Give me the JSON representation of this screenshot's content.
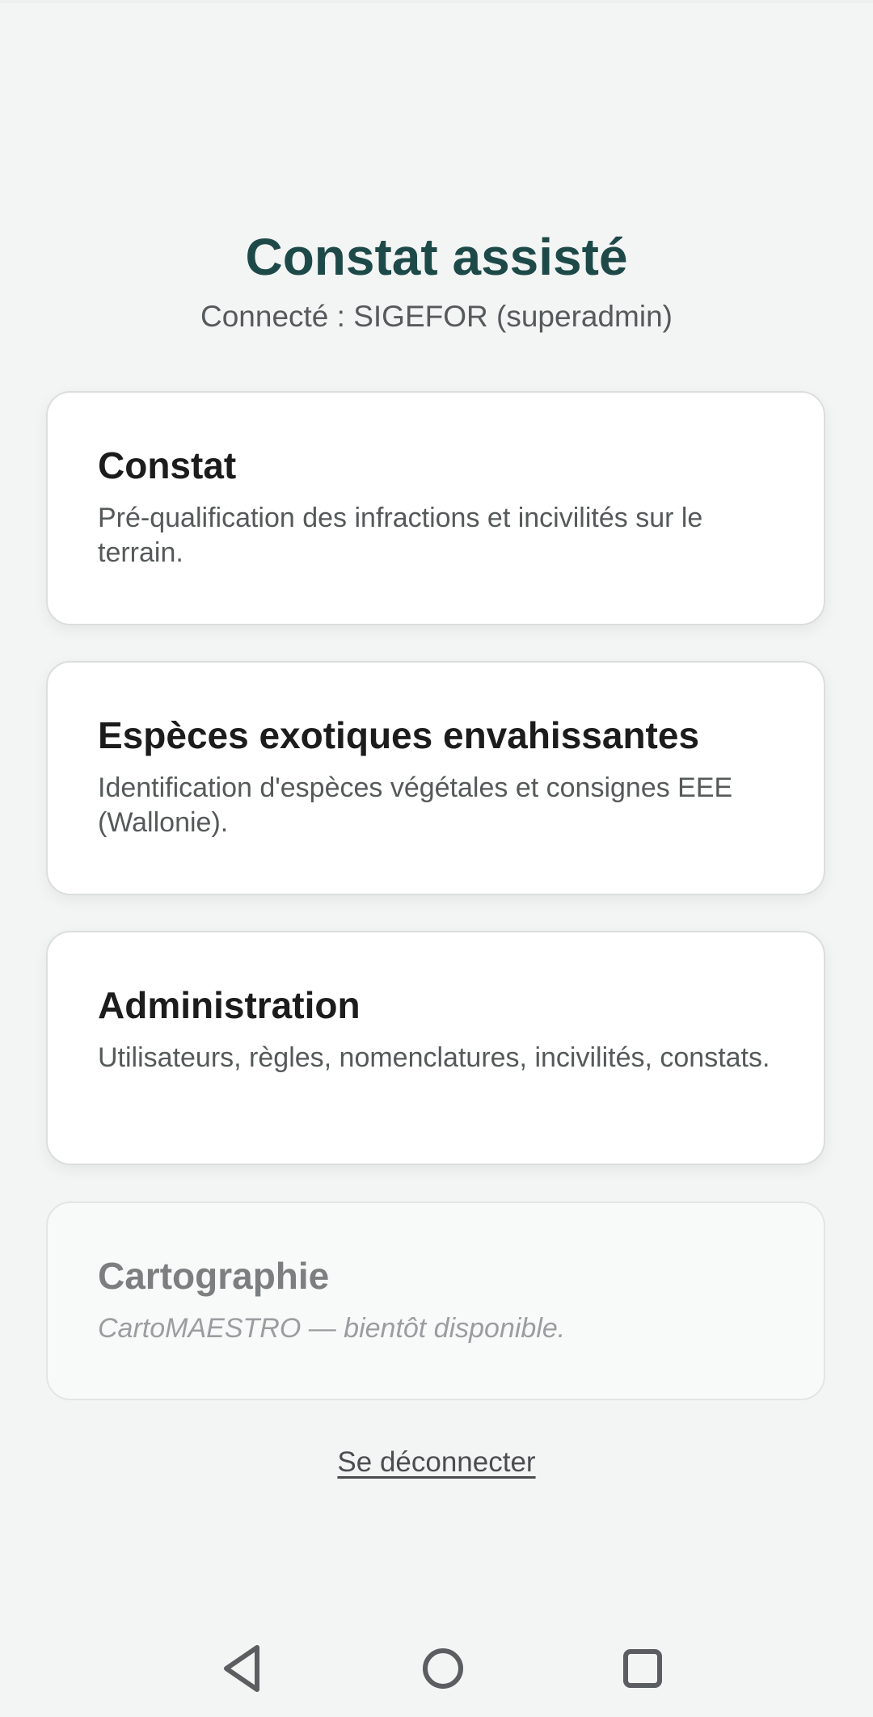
{
  "app": {
    "title": "Constat assisté",
    "subtitle": "Connecté : SIGEFOR (superadmin)"
  },
  "cards": [
    {
      "title": "Constat",
      "description": "Pré-qualification des infractions et incivilités sur le terrain.",
      "enabled": true
    },
    {
      "title": "Espèces exotiques envahissantes",
      "description": "Identification d'espèces végétales et consignes EEE (Wallonie).",
      "enabled": true
    },
    {
      "title": "Administration",
      "description": "Utilisateurs, règles, nomenclatures, incivilités, constats.",
      "enabled": true
    },
    {
      "title": "Cartographie",
      "description": "CartoMAESTRO — bientôt disponible.",
      "enabled": false
    }
  ],
  "logout": {
    "label": "Se déconnecter"
  },
  "navbar": {
    "icons": [
      "back-triangle-icon",
      "home-circle-icon",
      "recents-square-icon"
    ]
  },
  "colors": {
    "accent": "#1d4a48",
    "background": "#f3f4f4",
    "card": "#ffffff"
  }
}
